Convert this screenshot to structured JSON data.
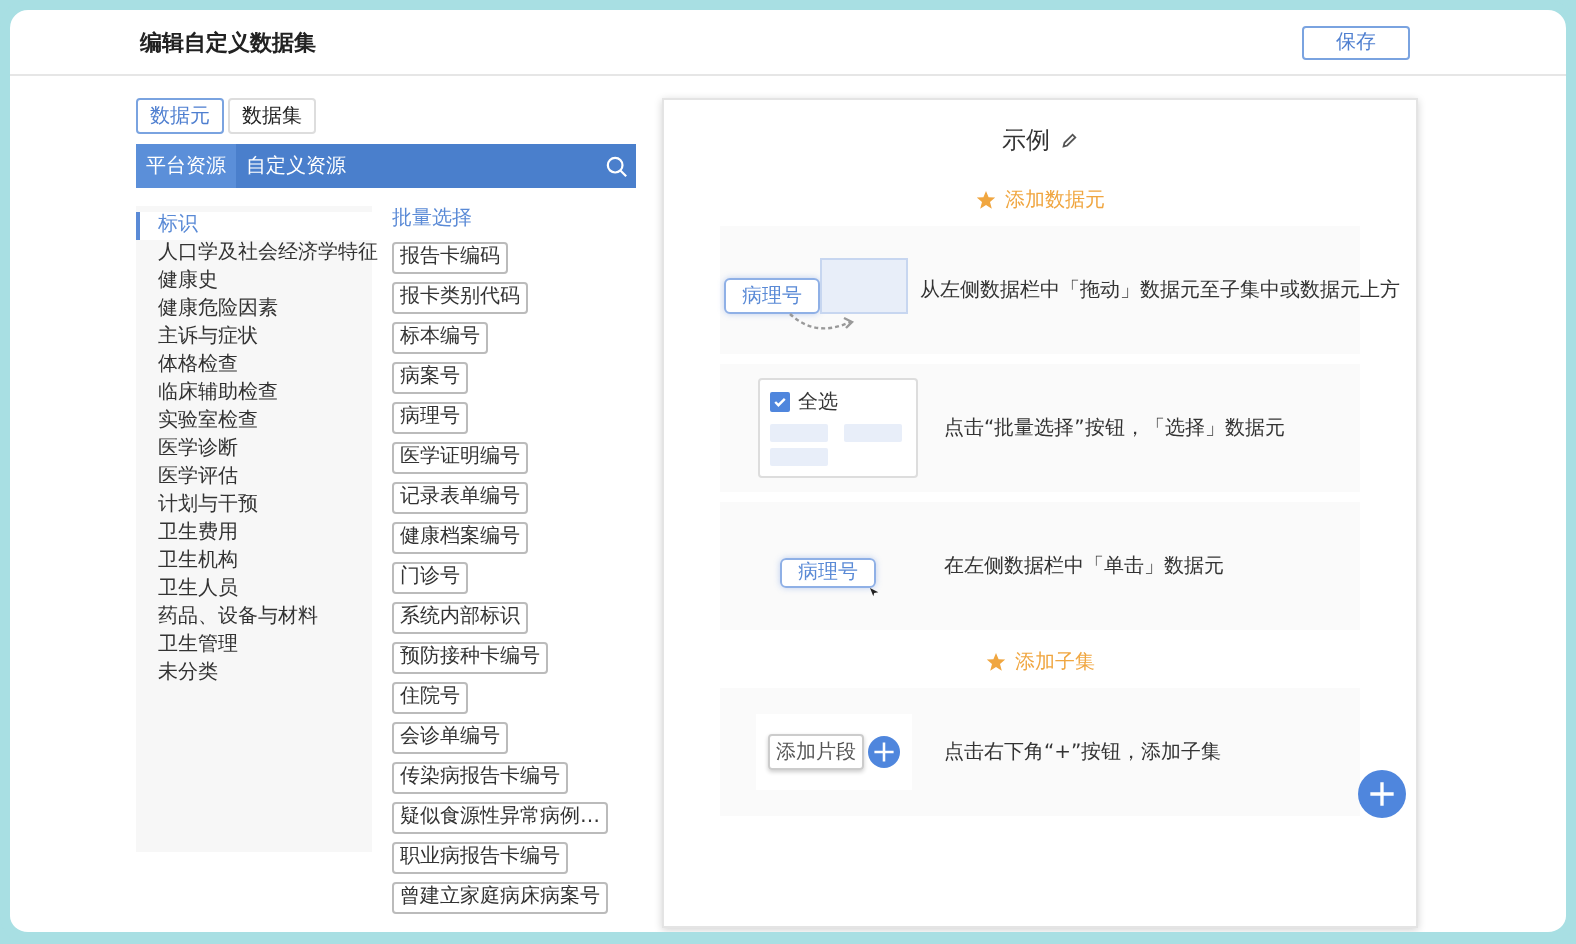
{
  "header": {
    "title": "编辑自定义数据集",
    "save_button": "保存"
  },
  "left_tabs": [
    {
      "label": "数据元",
      "selected": true
    },
    {
      "label": "数据集",
      "selected": false
    }
  ],
  "resource_tabs": [
    {
      "label": "平台资源",
      "selected": true
    },
    {
      "label": "自定义资源",
      "selected": false
    }
  ],
  "categories": [
    {
      "label": "标识",
      "selected": true
    },
    {
      "label": "人口学及社会经济学特征",
      "selected": false
    },
    {
      "label": "健康史",
      "selected": false
    },
    {
      "label": "健康危险因素",
      "selected": false
    },
    {
      "label": "主诉与症状",
      "selected": false
    },
    {
      "label": "体格检查",
      "selected": false
    },
    {
      "label": "临床辅助检查",
      "selected": false
    },
    {
      "label": "实验室检查",
      "selected": false
    },
    {
      "label": "医学诊断",
      "selected": false
    },
    {
      "label": "医学评估",
      "selected": false
    },
    {
      "label": "计划与干预",
      "selected": false
    },
    {
      "label": "卫生费用",
      "selected": false
    },
    {
      "label": "卫生机构",
      "selected": false
    },
    {
      "label": "卫生人员",
      "selected": false
    },
    {
      "label": "药品、设备与材料",
      "selected": false
    },
    {
      "label": "卫生管理",
      "selected": false
    },
    {
      "label": "未分类",
      "selected": false
    }
  ],
  "batch_select": "批量选择",
  "elements": [
    "报告卡编码",
    "报卡类别代码",
    "标本编号",
    "病案号",
    "病理号",
    "医学证明编号",
    "记录表单编号",
    "健康档案编号",
    "门诊号",
    "系统内部标识",
    "预防接种卡编号",
    "住院号",
    "会诊单编号",
    "传染病报告卡编号",
    "疑似食源性异常病例…",
    "职业病报告卡编号",
    "曾建立家庭病床病案号"
  ],
  "example": {
    "title": "示例",
    "sections": [
      {
        "heading": "添加数据元",
        "steps": [
          {
            "kind": "drag",
            "demo_label": "病理号",
            "text": "从左侧数据栏中「拖动」数据元至子集中或数据元上方"
          },
          {
            "kind": "batch",
            "demo_label": "全选",
            "checked": true,
            "text": "点击“批量选择”按钮，「选择」数据元"
          },
          {
            "kind": "click",
            "demo_label": "病理号",
            "text": "在左侧数据栏中「单击」数据元"
          }
        ]
      },
      {
        "heading": "添加子集",
        "steps": [
          {
            "kind": "add",
            "demo_label": "添加片段",
            "text": "点击右下角“+”按钮，添加子集"
          }
        ]
      }
    ]
  }
}
